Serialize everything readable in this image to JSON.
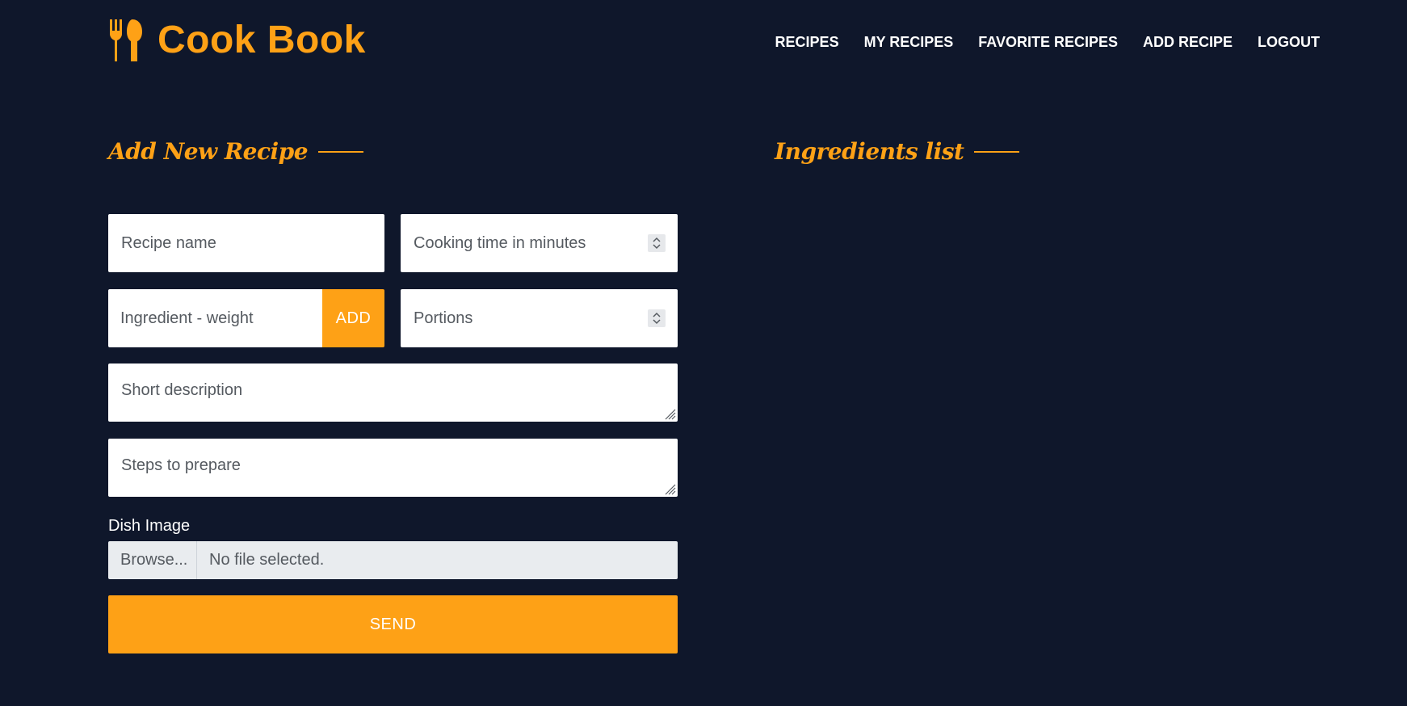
{
  "brand": {
    "name": "Cook Book",
    "icon": "utensils-icon",
    "color": "#fea116"
  },
  "nav": {
    "items": [
      {
        "label": "Recipes"
      },
      {
        "label": "My Recipes"
      },
      {
        "label": "Favorite Recipes"
      },
      {
        "label": "Add Recipe"
      },
      {
        "label": "Logout"
      }
    ]
  },
  "form": {
    "title": "Add New Recipe",
    "recipe_name": {
      "placeholder": "Recipe name",
      "value": ""
    },
    "cooking_time": {
      "placeholder": "Cooking time in minutes",
      "value": ""
    },
    "ingredient": {
      "placeholder": "Ingredient - weight",
      "value": ""
    },
    "add_label": "ADD",
    "portions": {
      "placeholder": "Portions",
      "value": ""
    },
    "description": {
      "placeholder": "Short description",
      "value": ""
    },
    "steps": {
      "placeholder": "Steps to prepare",
      "value": ""
    },
    "image_label": "Dish Image",
    "browse_label": "Browse...",
    "file_status": "No file selected.",
    "send_label": "SEND"
  },
  "ingredients": {
    "title": "Ingredients list",
    "items": []
  },
  "colors": {
    "background": "#0f172b",
    "accent": "#fea116",
    "text": "#ffffff"
  }
}
